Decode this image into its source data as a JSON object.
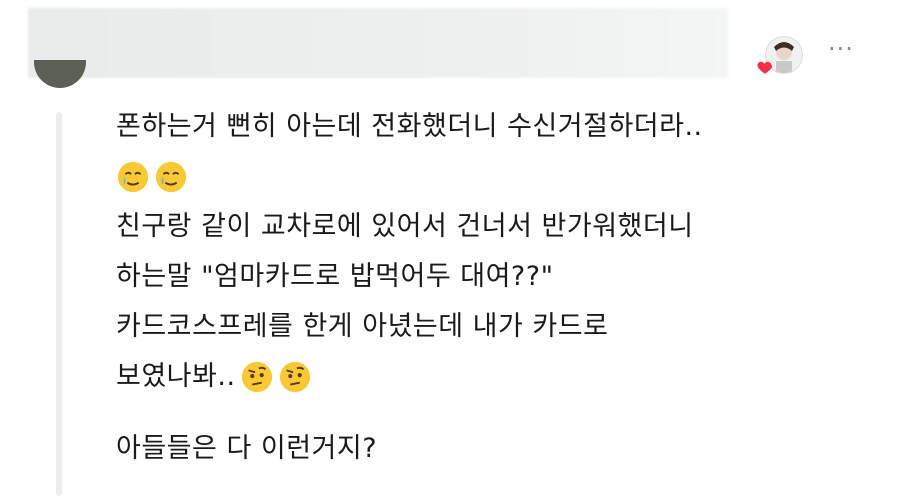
{
  "comment": {
    "lines": [
      "폰하는거 뻔히 아는데 전화했더니 수신거절하더라..",
      "",
      "친구랑 같이 교차로에 있어서 건너서 반가워했더니",
      "하는말 \"엄마카드로 밥먹어두 대여??\"",
      "카드코스프레를 한게 아녔는데 내가 카드로",
      "보였나봐..",
      "아들들은 다 이런거지?"
    ],
    "emoji_rows": {
      "row2": [
        "smiling-face-with-tear",
        "smiling-face-with-tear"
      ],
      "row6": [
        "face-with-raised-eyebrow",
        "face-with-raised-eyebrow"
      ]
    }
  },
  "actions": {
    "more_label": "···"
  },
  "colors": {
    "heart": "#f2304a",
    "emoji_yellow": "#f8c935",
    "thread_line": "#ececec"
  }
}
